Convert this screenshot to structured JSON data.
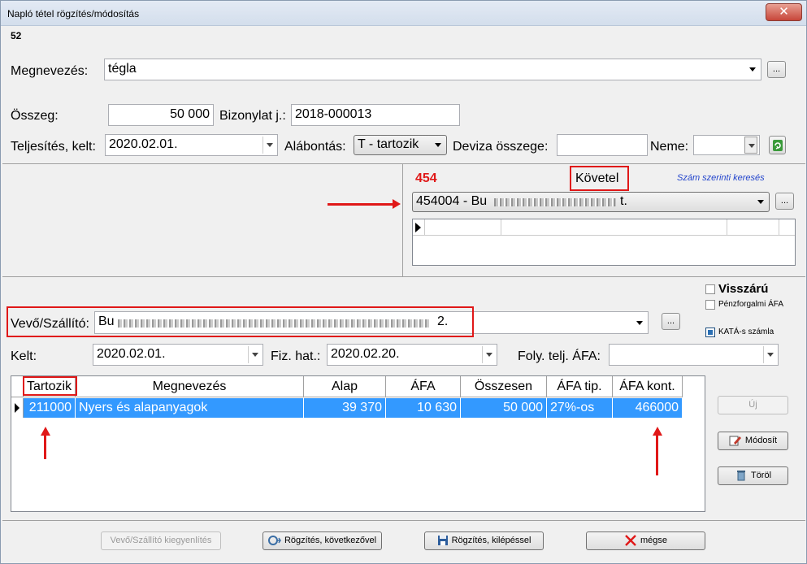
{
  "window": {
    "title": "Napló tétel rögzítés/módosítás",
    "close": "✕"
  },
  "record_number": "52",
  "form": {
    "megnevezes_label": "Megnevezés:",
    "megnevezes_value": "tégla",
    "dots": "...",
    "osszeg_label": "Összeg:",
    "osszeg_value": "50 000",
    "bizonylat_label": "Bizonylat j.:",
    "bizonylat_value": "2018-000013",
    "teljesites_label": "Teljesítés, kelt:",
    "teljesites_value": "2020.02.01.",
    "alabontas_label": "Alábontás:",
    "alabontas_value": "T - tartozik",
    "deviza_label": "Deviza összege:",
    "deviza_value": "",
    "neme_label": "Neme:",
    "neme_value": ""
  },
  "account": {
    "number": "454",
    "side": "Követel",
    "search_link": "Szám szerinti keresés",
    "selected_prefix": "454004 - Bu",
    "selected_suffix": "t."
  },
  "partner": {
    "visszaru_label": "Visszárú",
    "penzforgalmi_label": "Pénzforgalmi ÁFA",
    "kata_label": "KATÁ-s számla",
    "vevo_label": "Vevő/Szállító:",
    "vevo_prefix": "Bu",
    "vevo_suffix": "2.",
    "kelt_label": "Kelt:",
    "kelt_value": "2020.02.01.",
    "fizhat_label": "Fiz. hat.:",
    "fizhat_value": "2020.02.20.",
    "foly_label": "Foly. telj. ÁFA:",
    "foly_value": ""
  },
  "grid": {
    "columns": [
      "Tartozik",
      "Megnevezés",
      "Alap",
      "ÁFA",
      "Összesen",
      "ÁFA tip.",
      "ÁFA kont."
    ],
    "rows": [
      [
        "211000",
        "Nyers és alapanyagok",
        "39 370",
        "10 630",
        "50 000",
        "27%-os",
        "466000"
      ]
    ]
  },
  "side_buttons": {
    "uj": "Új",
    "modosit": "Módosít",
    "torol": "Töröl"
  },
  "bottom_buttons": {
    "kiegyenlites": "Vevő/Szállító kiegyenlítés",
    "kovetkezovel": "Rögzítés, következővel",
    "kilepessel": "Rögzítés, kilépéssel",
    "megse": "mégse"
  },
  "colors": {
    "annotation": "#e01818",
    "selection": "#3399ff",
    "account_number": "#e01818",
    "link": "#2244cc"
  }
}
